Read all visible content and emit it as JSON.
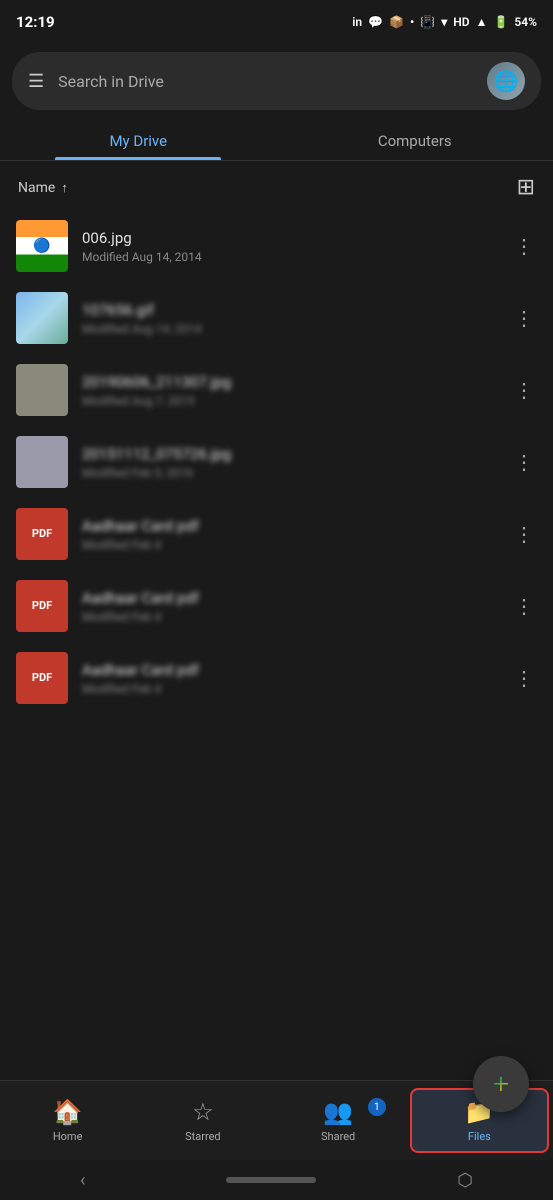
{
  "statusBar": {
    "time": "12:19",
    "batteryPercent": "54%",
    "signal": "HD"
  },
  "searchBar": {
    "placeholder": "Search in Drive"
  },
  "tabs": [
    {
      "id": "my-drive",
      "label": "My Drive",
      "active": true
    },
    {
      "id": "computers",
      "label": "Computers",
      "active": false
    }
  ],
  "sortRow": {
    "label": "Name",
    "direction": "↑",
    "viewToggleIcon": "grid"
  },
  "files": [
    {
      "id": 1,
      "name": "006.jpg",
      "meta": "Modified Aug 14, 2014",
      "thumbType": "india",
      "blurred": false
    },
    {
      "id": 2,
      "name": "107656.gif",
      "meta": "Modified Aug 14, 2014",
      "thumbType": "building",
      "blurred": true
    },
    {
      "id": 3,
      "name": "20190606_211307.jpg",
      "meta": "Modified Aug 7, 2019",
      "thumbType": "gray1",
      "blurred": true
    },
    {
      "id": 4,
      "name": "20151112_075726.jpg",
      "meta": "Modified Feb 5, 2016",
      "thumbType": "gray2",
      "blurred": true
    },
    {
      "id": 5,
      "name": "Aadhaar Card pdf",
      "meta": "Modified Feb 4",
      "thumbType": "red",
      "blurred": true
    },
    {
      "id": 6,
      "name": "Aadhaar Card pdf",
      "meta": "Modified Feb 4",
      "thumbType": "red",
      "blurred": true
    },
    {
      "id": 7,
      "name": "Aadhaar Card pdf",
      "meta": "Modified Feb 4",
      "thumbType": "red",
      "blurred": true
    }
  ],
  "fab": {
    "label": "+"
  },
  "bottomNav": [
    {
      "id": "home",
      "label": "Home",
      "icon": "🏠",
      "active": false,
      "badge": null
    },
    {
      "id": "starred",
      "label": "Starred",
      "icon": "☆",
      "active": false,
      "badge": null
    },
    {
      "id": "shared",
      "label": "Shared",
      "icon": "👥",
      "active": false,
      "badge": "1"
    },
    {
      "id": "files",
      "label": "Files",
      "icon": "📁",
      "active": true,
      "badge": null
    }
  ]
}
